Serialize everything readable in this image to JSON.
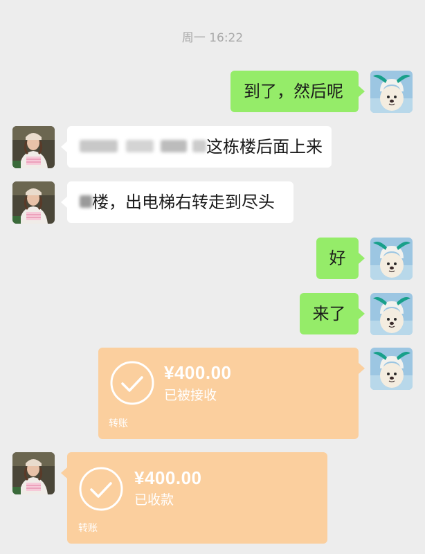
{
  "chat": {
    "timestamp": "周一 16:22",
    "messages": [
      {
        "sender": "me",
        "type": "text",
        "text": "到了，然后呢",
        "avatar": "dog-avatar"
      },
      {
        "sender": "other",
        "type": "text",
        "text": "这栋楼后面上来",
        "redacted_prefix": true,
        "avatar": "woman-avatar"
      },
      {
        "sender": "other",
        "type": "text",
        "text": "楼，出电梯右转走到尽头",
        "redacted_prefix": true,
        "avatar": "woman-avatar"
      },
      {
        "sender": "me",
        "type": "text",
        "text": "好",
        "avatar": "dog-avatar"
      },
      {
        "sender": "me",
        "type": "text",
        "text": "来了",
        "avatar": "dog-avatar"
      },
      {
        "sender": "me",
        "type": "transfer",
        "amount": "¥400.00",
        "status": "已被接收",
        "label": "转账",
        "avatar": "dog-avatar"
      },
      {
        "sender": "other",
        "type": "transfer",
        "amount": "¥400.00",
        "status": "已收款",
        "label": "转账",
        "avatar": "woman-avatar"
      }
    ]
  },
  "colors": {
    "background": "#ededed",
    "my_bubble": "#95ec69",
    "their_bubble": "#ffffff",
    "transfer": "#fbcf9e",
    "timestamp": "#a8a8a8"
  }
}
